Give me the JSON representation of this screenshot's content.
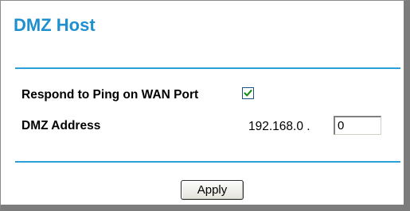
{
  "panel": {
    "title": "DMZ Host"
  },
  "ping": {
    "label": "Respond to Ping on WAN Port",
    "checked": true
  },
  "dmz": {
    "label": "DMZ Address",
    "ip_prefix": "192.168.0 .",
    "last_octet_value": "0"
  },
  "actions": {
    "apply_label": "Apply"
  },
  "colors": {
    "title": "#1e8fcf",
    "divider": "#2aa0d8",
    "checkmark": "#1a8f1a",
    "frame_shadow": "#7c7c7c"
  }
}
